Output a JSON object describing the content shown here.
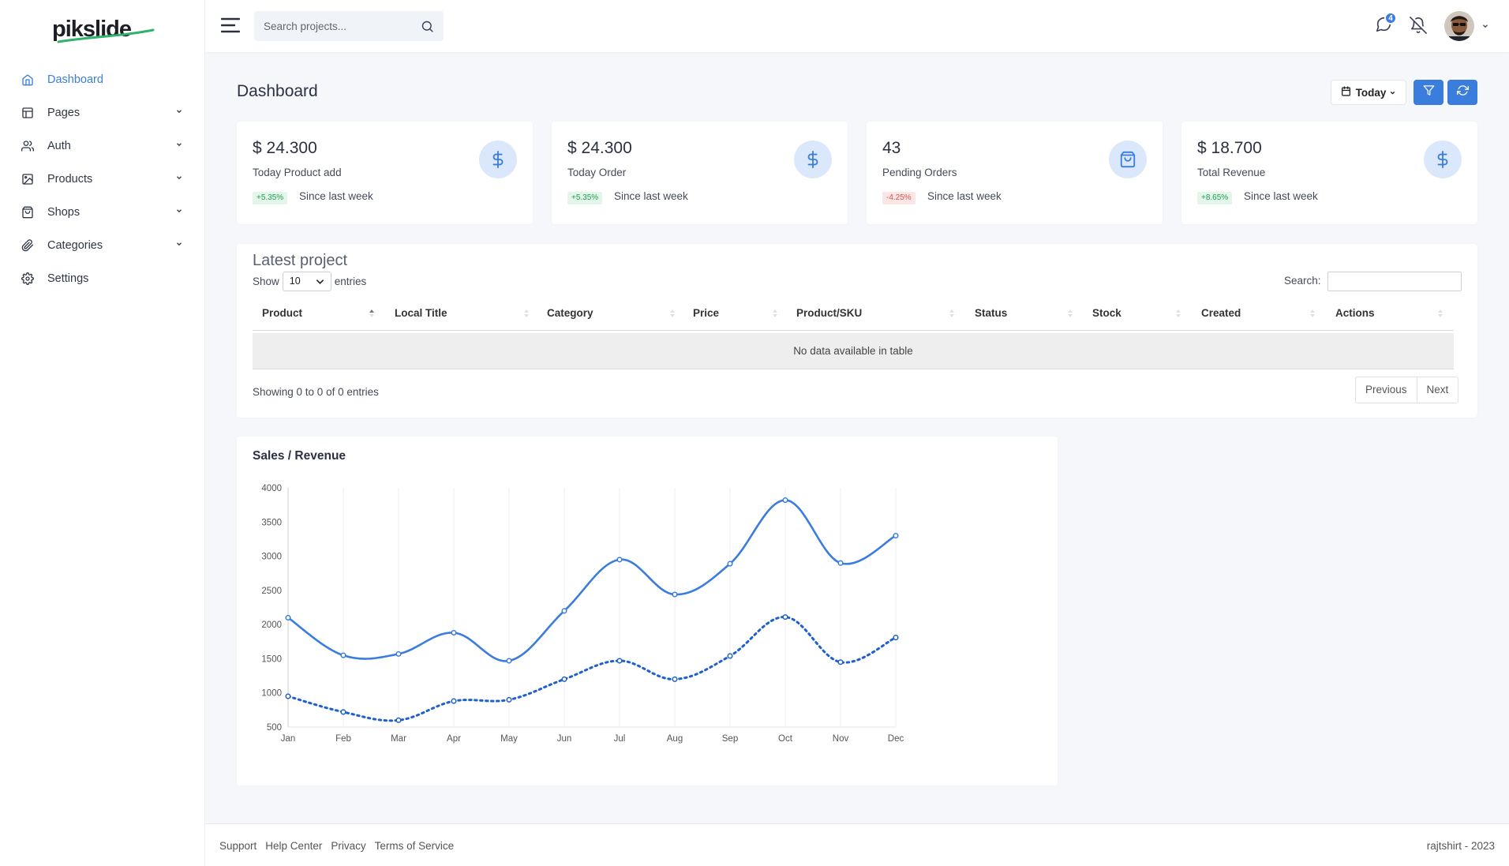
{
  "brand": {
    "logo_text": "pikslide"
  },
  "sidebar": {
    "items": [
      {
        "label": "Dashboard",
        "icon": "home-icon",
        "active": true,
        "has_submenu": false
      },
      {
        "label": "Pages",
        "icon": "layout-icon",
        "active": false,
        "has_submenu": true
      },
      {
        "label": "Auth",
        "icon": "users-icon",
        "active": false,
        "has_submenu": true
      },
      {
        "label": "Products",
        "icon": "image-icon",
        "active": false,
        "has_submenu": true
      },
      {
        "label": "Shops",
        "icon": "shopping-bag-icon",
        "active": false,
        "has_submenu": true
      },
      {
        "label": "Categories",
        "icon": "paperclip-icon",
        "active": false,
        "has_submenu": true
      },
      {
        "label": "Settings",
        "icon": "gear-icon",
        "active": false,
        "has_submenu": false
      }
    ]
  },
  "topbar": {
    "search_placeholder": "Search projects...",
    "message_count": "4"
  },
  "page": {
    "title": "Dashboard",
    "date_filter": "Today"
  },
  "stats": [
    {
      "value": "$ 24.300",
      "label": "Today Product add",
      "change": "+5.35%",
      "trend": "up",
      "since": "Since last week",
      "icon": "dollar-icon"
    },
    {
      "value": "$ 24.300",
      "label": "Today Order",
      "change": "+5.35%",
      "trend": "up",
      "since": "Since last week",
      "icon": "dollar-icon"
    },
    {
      "value": "43",
      "label": "Pending Orders",
      "change": "-4.25%",
      "trend": "down",
      "since": "Since last week",
      "icon": "shopping-bag-icon"
    },
    {
      "value": "$ 18.700",
      "label": "Total Revenue",
      "change": "+8.65%",
      "trend": "up",
      "since": "Since last week",
      "icon": "dollar-icon"
    }
  ],
  "table": {
    "title": "Latest project",
    "show_label": "Show",
    "entries_value": "10",
    "entries_label": "entries",
    "search_label": "Search:",
    "columns": [
      "Product",
      "Local Title",
      "Category",
      "Price",
      "Product/SKU",
      "Status",
      "Stock",
      "Created",
      "Actions"
    ],
    "empty_message": "No data available in table",
    "info": "Showing 0 to 0 of 0 entries",
    "prev_label": "Previous",
    "next_label": "Next"
  },
  "chart_data": {
    "type": "line",
    "title": "Sales / Revenue",
    "categories": [
      "Jan",
      "Feb",
      "Mar",
      "Apr",
      "May",
      "Jun",
      "Jul",
      "Aug",
      "Sep",
      "Oct",
      "Nov",
      "Dec"
    ],
    "ylim": [
      500,
      4000
    ],
    "yticks": [
      500,
      1000,
      1500,
      2000,
      2500,
      3000,
      3500,
      4000
    ],
    "series": [
      {
        "values": [
          2100,
          1550,
          1570,
          1880,
          1470,
          2200,
          2950,
          2440,
          2890,
          3820,
          2900,
          3300
        ],
        "style": "solid",
        "color": "#3b7ddd"
      },
      {
        "values": [
          950,
          720,
          600,
          880,
          900,
          1200,
          1470,
          1200,
          1540,
          2110,
          1450,
          1810
        ],
        "style": "dotted",
        "color": "#2060cc"
      }
    ],
    "grid_x": true,
    "grid_y": false
  },
  "footer": {
    "links": [
      "Support",
      "Help Center",
      "Privacy",
      "Terms of Service"
    ],
    "copyright": "rajtshirt - 2023"
  }
}
